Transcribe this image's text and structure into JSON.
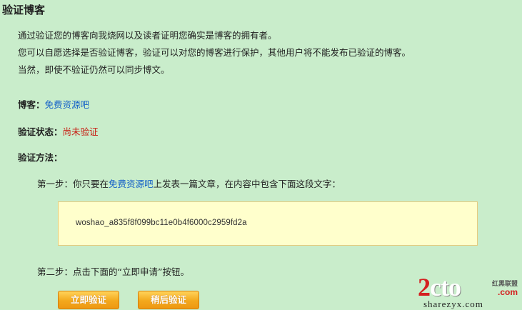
{
  "page": {
    "title": "验证博客"
  },
  "intro": {
    "lines": [
      "通过验证您的博客向我烧网以及读者证明您确实是博客的拥有者。",
      "您可以自愿选择是否验证博客，验证可以对您的博客进行保护，其他用户将不能发布已验证的博客。",
      "当然，即使不验证仍然可以同步博文。"
    ]
  },
  "fields": {
    "blog_label": "博客：",
    "blog_value": "免费资源吧",
    "status_label": "验证状态：",
    "status_value": "尚未验证",
    "method_label": "验证方法："
  },
  "steps": {
    "step1_prefix": "第一步：你只要在",
    "step1_link": "免费资源吧",
    "step1_suffix": "上发表一篇文章，在内容中包含下面这段文字：",
    "code": "woshao_a835f8f099bc11e0b4f6000c2959fd2a",
    "step2": "第二步：点击下面的“立即申请”按钮。"
  },
  "buttons": {
    "verify_now": "立即验证",
    "verify_later": "稍后验证"
  },
  "watermark": {
    "logo_a": "2",
    "logo_b": "cto",
    "brand": "红黑联盟",
    "com": ".com",
    "domain": "sharezyx.com"
  },
  "colors": {
    "background": "#c9edcb",
    "link": "#1561c8",
    "status_red": "#c81a10",
    "code_bg": "#ffffcc",
    "button": "#f3a81c"
  }
}
